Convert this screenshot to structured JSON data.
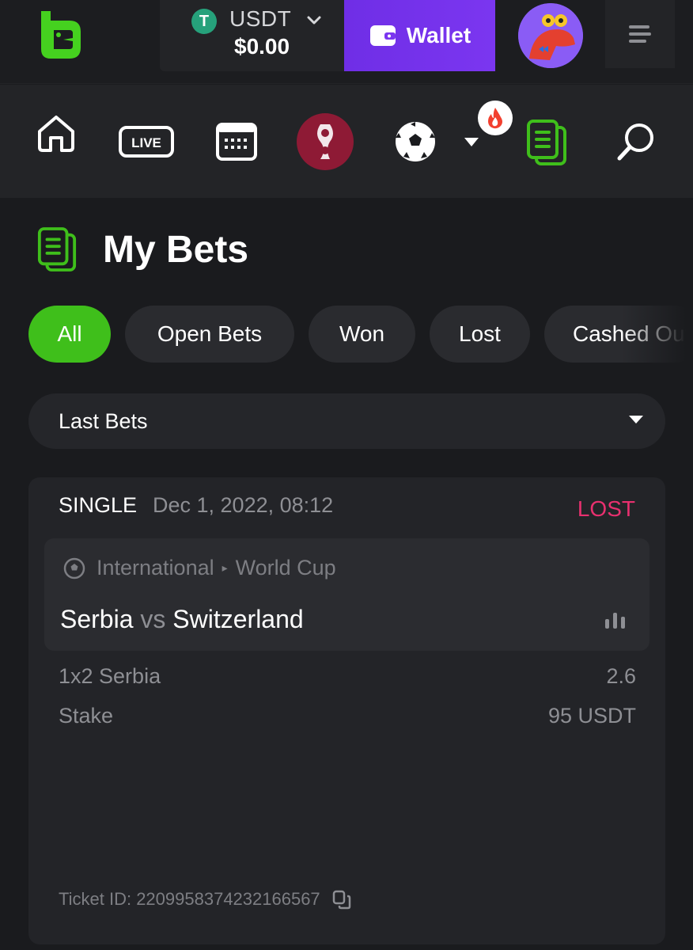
{
  "header": {
    "currency_label": "USDT",
    "currency_symbol": "T",
    "balance": "$0.00",
    "wallet_label": "Wallet"
  },
  "nav": {
    "items": [
      "home-icon",
      "live-icon",
      "calendar-icon",
      "world-cup-icon",
      "soccer-ball-icon",
      "dropdown-icon",
      "my-bets-icon",
      "search-icon"
    ],
    "live_text": "LIVE"
  },
  "page": {
    "title": "My Bets"
  },
  "filters": [
    "All",
    "Open Bets",
    "Won",
    "Lost",
    "Cashed Out"
  ],
  "dropdown": {
    "selected": "Last Bets"
  },
  "bet": {
    "type": "SINGLE",
    "date": "Dec 1, 2022, 08:12",
    "status": "LOST",
    "status_color": "#e8306f",
    "league_region": "International",
    "league_name": "World Cup",
    "team_home": "Serbia",
    "vs": "vs",
    "team_away": "Switzerland",
    "market_label": "1x2 Serbia",
    "odds": "2.6",
    "stake_label": "Stake",
    "stake_value": "95 USDT",
    "ticket_label": "Ticket ID: 2209958374232166567"
  },
  "colors": {
    "accent_green": "#3fbf1b",
    "wallet_purple": "#7b36f0"
  }
}
